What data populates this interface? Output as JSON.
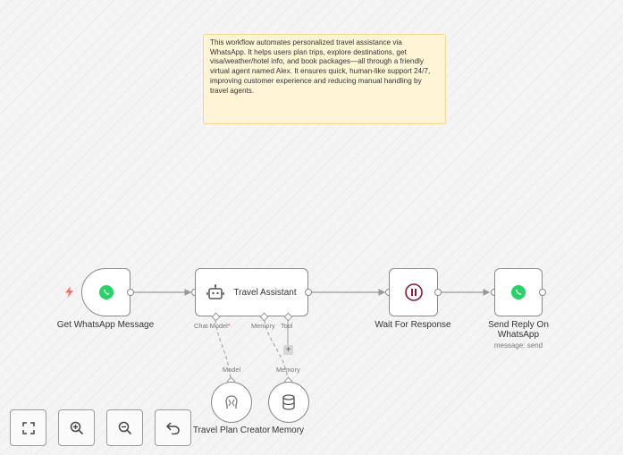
{
  "sticky_note": {
    "text": "This workflow automates personalized travel assistance via WhatsApp. It helps users plan trips, explore destinations, get visa/weather/hotel info, and book packages—all through a friendly virtual agent named Alex. It ensures quick, human-like support 24/7, improving customer experience and reducing manual handling by travel agents."
  },
  "nodes": {
    "trigger": {
      "label": "Get WhatsApp Message",
      "icon": "whatsapp-icon"
    },
    "agent": {
      "label": "Travel Assistant",
      "icon": "robot-icon",
      "ports": {
        "chat_model": "Chat Model",
        "required_mark": "*",
        "memory": "Memory",
        "tool": "Tool"
      }
    },
    "wait": {
      "label": "Wait For Response",
      "icon": "pause-icon"
    },
    "send": {
      "label": "Send Reply On WhatsApp",
      "subtitle": "message: send",
      "icon": "whatsapp-icon"
    },
    "model": {
      "label": "Travel Plan Creator",
      "port": "Model",
      "icon": "ai-model-icon"
    },
    "memory": {
      "label": "Memory",
      "port": "Memory",
      "icon": "database-icon"
    }
  },
  "colors": {
    "whatsapp": "#25d366",
    "pause": "#8b1d3a",
    "trigger_bolt": "#ff6d5a",
    "sticky": "#fff5d6"
  },
  "controls": {
    "add_tool": "+",
    "items": [
      {
        "name": "fit-view",
        "icon": "fit-view-icon"
      },
      {
        "name": "zoom-in",
        "icon": "zoom-in-icon"
      },
      {
        "name": "zoom-out",
        "icon": "zoom-out-icon"
      },
      {
        "name": "undo",
        "icon": "undo-icon"
      }
    ]
  }
}
